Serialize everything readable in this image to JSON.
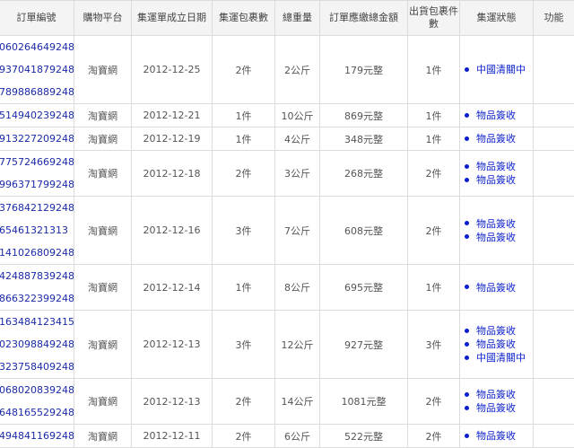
{
  "headers": {
    "order_no": "訂單編號",
    "platform": "購物平台",
    "date": "集運單成立日期",
    "packages": "集運包裹數",
    "weight": "總重量",
    "amount": "訂單應繳總金額",
    "shipped": "出貨包裹件數",
    "status": "集運狀態",
    "action": "功能"
  },
  "rows": [
    {
      "orders": [
        "060264649248",
        "937041879248",
        "789886889248"
      ],
      "platform": "淘寶網",
      "date": "2012-12-25",
      "packages": "2件",
      "weight": "2公斤",
      "amount": "179元整",
      "shipped": "1件",
      "statuses": [
        "中國清關中"
      ]
    },
    {
      "orders": [
        "514940239248"
      ],
      "platform": "淘寶網",
      "date": "2012-12-21",
      "packages": "1件",
      "weight": "10公斤",
      "amount": "869元整",
      "shipped": "1件",
      "statuses": [
        "物品簽收"
      ]
    },
    {
      "orders": [
        "913227209248"
      ],
      "platform": "淘寶網",
      "date": "2012-12-19",
      "packages": "1件",
      "weight": "4公斤",
      "amount": "348元整",
      "shipped": "1件",
      "statuses": [
        "物品簽收"
      ]
    },
    {
      "orders": [
        "775724669248",
        "996371799248"
      ],
      "platform": "淘寶網",
      "date": "2012-12-18",
      "packages": "2件",
      "weight": "3公斤",
      "amount": "268元整",
      "shipped": "2件",
      "statuses": [
        "物品簽收",
        "物品簽收"
      ]
    },
    {
      "orders": [
        "376842129248",
        "65461321313",
        "141026809248"
      ],
      "platform": "淘寶網",
      "date": "2012-12-16",
      "packages": "3件",
      "weight": "7公斤",
      "amount": "608元整",
      "shipped": "2件",
      "statuses": [
        "物品簽收",
        "物品簽收"
      ]
    },
    {
      "orders": [
        "424887839248",
        "866322399248"
      ],
      "platform": "淘寶網",
      "date": "2012-12-14",
      "packages": "1件",
      "weight": "8公斤",
      "amount": "695元整",
      "shipped": "1件",
      "statuses": [
        "物品簽收"
      ]
    },
    {
      "orders": [
        "163484123415",
        "023098849248",
        "323758409248"
      ],
      "platform": "淘寶網",
      "date": "2012-12-13",
      "packages": "3件",
      "weight": "12公斤",
      "amount": "927元整",
      "shipped": "3件",
      "statuses": [
        "物品簽收",
        "物品簽收",
        "中國清關中"
      ]
    },
    {
      "orders": [
        "068020839248",
        "648165529248"
      ],
      "platform": "淘寶網",
      "date": "2012-12-13",
      "packages": "2件",
      "weight": "14公斤",
      "amount": "1081元整",
      "shipped": "2件",
      "statuses": [
        "物品簽收",
        "物品簽收"
      ]
    },
    {
      "orders": [
        "494841169248"
      ],
      "platform": "淘寶網",
      "date": "2012-12-11",
      "packages": "2件",
      "weight": "6公斤",
      "amount": "522元整",
      "shipped": "2件",
      "statuses": [
        "物品簽收"
      ]
    }
  ]
}
